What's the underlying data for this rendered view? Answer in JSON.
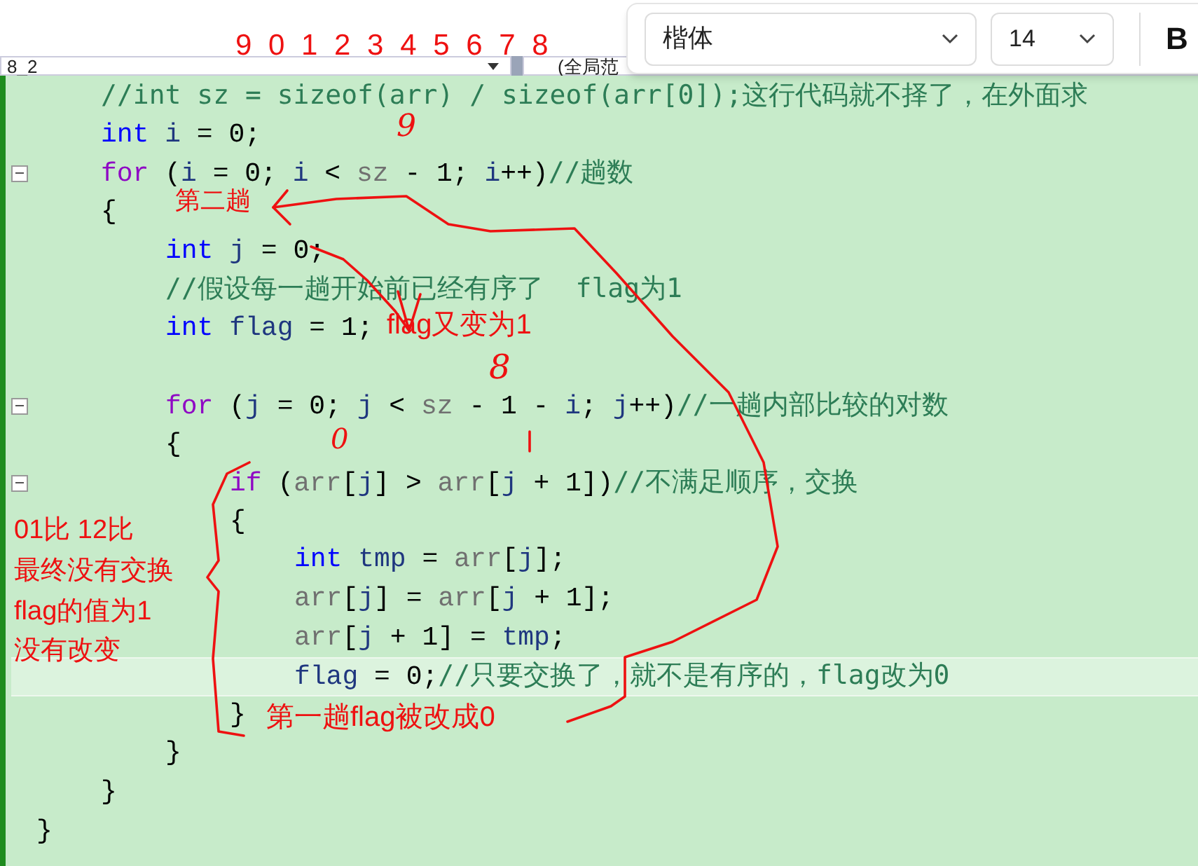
{
  "nav_bar": {
    "scope": "8_2",
    "global": "(全局范"
  },
  "font_toolbar": {
    "font": "楷体",
    "size": "14",
    "bold": "B"
  },
  "code_lines": [
    {
      "children": [
        {
          "fold": false,
          "current": false,
          "tokens": [
            {
              "kind": "comment",
              "text": "//int sz = sizeof(arr) / sizeof(arr[0]);这行代码就不择了，在外面求"
            }
          ]
        },
        {
          "fold": false,
          "current": false,
          "tokens": [
            {
              "kind": "kw",
              "text": "int"
            },
            {
              "kind": "var",
              "text": " i"
            },
            {
              "kind": "plain",
              "text": " = 0;"
            }
          ]
        },
        {
          "fold": true,
          "current": false,
          "tokens": [
            {
              "kind": "ctrl",
              "text": "for"
            },
            {
              "kind": "plain",
              "text": " ("
            },
            {
              "kind": "var",
              "text": "i"
            },
            {
              "kind": "plain",
              "text": " = 0; "
            },
            {
              "kind": "var",
              "text": "i"
            },
            {
              "kind": "plain",
              "text": " < "
            },
            {
              "kind": "param",
              "text": "sz"
            },
            {
              "kind": "plain",
              "text": " - 1; "
            },
            {
              "kind": "var",
              "text": "i"
            },
            {
              "kind": "plain",
              "text": "++)"
            },
            {
              "kind": "comment",
              "text": "//趟数"
            }
          ]
        },
        {
          "fold": false,
          "current": false,
          "tokens": [
            {
              "kind": "plain",
              "text": "{"
            }
          ],
          "children": [
            {
              "fold": false,
              "current": false,
              "tokens": [
                {
                  "kind": "kw",
                  "text": "int"
                },
                {
                  "kind": "var",
                  "text": " j"
                },
                {
                  "kind": "plain",
                  "text": " = 0;"
                }
              ]
            },
            {
              "fold": false,
              "current": false,
              "tokens": [
                {
                  "kind": "comment",
                  "text": "//假设每一趟开始前已经有序了  flag为1"
                }
              ]
            },
            {
              "fold": false,
              "current": false,
              "tokens": [
                {
                  "kind": "kw",
                  "text": "int"
                },
                {
                  "kind": "var",
                  "text": " flag"
                },
                {
                  "kind": "plain",
                  "text": " = 1;"
                }
              ]
            },
            {
              "fold": false,
              "current": false
            },
            {
              "fold": true,
              "current": false,
              "tokens": [
                {
                  "kind": "ctrl",
                  "text": "for"
                },
                {
                  "kind": "plain",
                  "text": " ("
                },
                {
                  "kind": "var",
                  "text": "j"
                },
                {
                  "kind": "plain",
                  "text": " = 0; "
                },
                {
                  "kind": "var",
                  "text": "j"
                },
                {
                  "kind": "plain",
                  "text": " < "
                },
                {
                  "kind": "param",
                  "text": "sz"
                },
                {
                  "kind": "plain",
                  "text": " - 1 - "
                },
                {
                  "kind": "var",
                  "text": "i"
                },
                {
                  "kind": "plain",
                  "text": "; "
                },
                {
                  "kind": "var",
                  "text": "j"
                },
                {
                  "kind": "plain",
                  "text": "++)"
                },
                {
                  "kind": "comment",
                  "text": "//一趟内部比较的对数"
                }
              ]
            },
            {
              "fold": false,
              "current": false,
              "tokens": [
                {
                  "kind": "plain",
                  "text": "{"
                }
              ],
              "children": [
                {
                  "fold": true,
                  "current": false,
                  "tokens": [
                    {
                      "kind": "ctrl",
                      "text": "if"
                    },
                    {
                      "kind": "plain",
                      "text": " ("
                    },
                    {
                      "kind": "param",
                      "text": "arr"
                    },
                    {
                      "kind": "plain",
                      "text": "["
                    },
                    {
                      "kind": "var",
                      "text": "j"
                    },
                    {
                      "kind": "plain",
                      "text": "] > "
                    },
                    {
                      "kind": "param",
                      "text": "arr"
                    },
                    {
                      "kind": "plain",
                      "text": "["
                    },
                    {
                      "kind": "var",
                      "text": "j"
                    },
                    {
                      "kind": "plain",
                      "text": " + 1])"
                    },
                    {
                      "kind": "comment",
                      "text": "//不满足顺序，交换"
                    }
                  ]
                },
                {
                  "fold": false,
                  "current": false,
                  "tokens": [
                    {
                      "kind": "plain",
                      "text": "{"
                    }
                  ],
                  "children": [
                    {
                      "fold": false,
                      "current": false,
                      "tokens": [
                        {
                          "kind": "kw",
                          "text": "int"
                        },
                        {
                          "kind": "var",
                          "text": " tmp"
                        },
                        {
                          "kind": "plain",
                          "text": " = "
                        },
                        {
                          "kind": "param",
                          "text": "arr"
                        },
                        {
                          "kind": "plain",
                          "text": "["
                        },
                        {
                          "kind": "var",
                          "text": "j"
                        },
                        {
                          "kind": "plain",
                          "text": "];"
                        }
                      ]
                    },
                    {
                      "fold": false,
                      "current": false,
                      "tokens": [
                        {
                          "kind": "param",
                          "text": "arr"
                        },
                        {
                          "kind": "plain",
                          "text": "["
                        },
                        {
                          "kind": "var",
                          "text": "j"
                        },
                        {
                          "kind": "plain",
                          "text": "] = "
                        },
                        {
                          "kind": "param",
                          "text": "arr"
                        },
                        {
                          "kind": "plain",
                          "text": "["
                        },
                        {
                          "kind": "var",
                          "text": "j"
                        },
                        {
                          "kind": "plain",
                          "text": " + 1];"
                        }
                      ]
                    },
                    {
                      "fold": false,
                      "current": false,
                      "tokens": [
                        {
                          "kind": "param",
                          "text": "arr"
                        },
                        {
                          "kind": "plain",
                          "text": "["
                        },
                        {
                          "kind": "var",
                          "text": "j"
                        },
                        {
                          "kind": "plain",
                          "text": " + 1] = "
                        },
                        {
                          "kind": "var",
                          "text": "tmp"
                        },
                        {
                          "kind": "plain",
                          "text": ";"
                        }
                      ]
                    },
                    {
                      "fold": false,
                      "current": true,
                      "tokens": [
                        {
                          "kind": "var",
                          "text": "flag"
                        },
                        {
                          "kind": "plain",
                          "text": " = 0;"
                        },
                        {
                          "kind": "comment",
                          "text": "//只要交换了，就不是有序的，flag改为0"
                        }
                      ]
                    }
                  ]
                },
                {
                  "fold": false,
                  "current": false,
                  "tokens": [
                    {
                      "kind": "plain",
                      "text": "}"
                    }
                  ]
                }
              ]
            },
            {
              "fold": false,
              "current": false,
              "tokens": [
                {
                  "kind": "plain",
                  "text": "}"
                }
              ]
            }
          ]
        },
        {
          "fold": false,
          "current": false,
          "tokens": [
            {
              "kind": "plain",
              "text": "}"
            }
          ]
        }
      ]
    },
    {
      "fold": false,
      "current": false,
      "tokens": [
        {
          "kind": "plain",
          "text": "}"
        }
      ]
    }
  ],
  "annotations": [
    {
      "kind": "digits",
      "text": "9 0 1 2 3 4 5 6 7 8"
    },
    {
      "kind": "note",
      "text": "第二趟"
    },
    {
      "kind": "note",
      "text": "flag又变为1"
    },
    {
      "kind": "note",
      "text": "01比 12比"
    },
    {
      "kind": "note",
      "text": "最终没有交换"
    },
    {
      "kind": "note",
      "text": "flag的值为1"
    },
    {
      "kind": "note",
      "text": "没有改变"
    },
    {
      "kind": "note",
      "text": "第一趟flag被改成0"
    },
    {
      "kind": "scribble",
      "text": "9"
    },
    {
      "kind": "scribble",
      "text": "8"
    },
    {
      "kind": "scribble",
      "text": "0"
    }
  ]
}
